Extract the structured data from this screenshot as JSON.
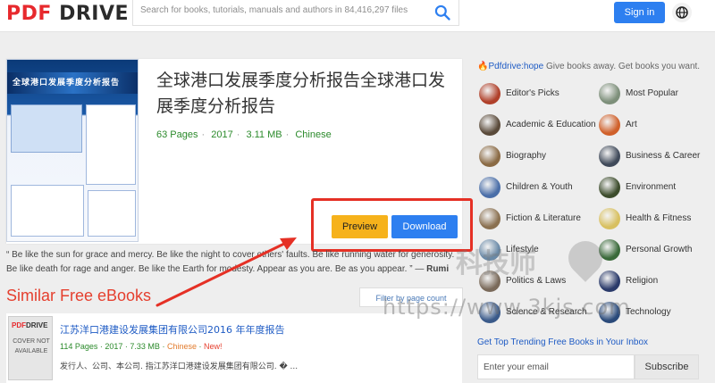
{
  "header": {
    "logo_pdf": "PDF",
    "logo_drive": "DRIVE",
    "search_placeholder": "Search for books, tutorials, manuals and authors in 84,416,297 files",
    "signin_label": "Sign in"
  },
  "book": {
    "cover_title": "全球港口发展季度分析报告",
    "title": "全球港口发展季度分析报告全球港口发展季度分析报告",
    "pages": "63 Pages",
    "year": "2017",
    "size": "3.11 MB",
    "language": "Chinese",
    "preview_label": "Preview",
    "download_label": "Download"
  },
  "quote": {
    "text": "“ Be like the sun for grace and mercy. Be like the night to cover others' faults. Be like running water for generosity. Be like death for rage and anger. Be like the Earth for modesty. Appear as you are. Be as you appear. ” — ",
    "author": "Rumi"
  },
  "similar": {
    "heading": "Similar Free eBooks",
    "filter_label": "Filter by page count",
    "items": [
      {
        "thumb_logo_pdf": "PDF",
        "thumb_logo_drive": "DRIVE",
        "thumb_text": "COVER NOT AVAILABLE",
        "title": "江苏洋口港建设发展集团有限公司2016 年年度报告",
        "pages": "114 Pages",
        "year": "2017",
        "size": "7.33 MB",
        "language": "Chinese",
        "badge": "New!",
        "snippet": "发行人、公司、本公司. 指江苏洋口港建设发展集团有限公司. �  ..."
      }
    ]
  },
  "sidebar": {
    "hope_brand": "Pdfdrive:hope",
    "hope_text": " Give books away. Get books you want.",
    "categories": [
      {
        "label": "Editor's Picks",
        "color": "#b0402a"
      },
      {
        "label": "Most Popular",
        "color": "#7d8f7a"
      },
      {
        "label": "Academic & Education",
        "color": "#5a4a3a"
      },
      {
        "label": "Art",
        "color": "#d0602a"
      },
      {
        "label": "Biography",
        "color": "#8a6a44"
      },
      {
        "label": "Business & Career",
        "color": "#404a5a"
      },
      {
        "label": "Children & Youth",
        "color": "#4a6ea8"
      },
      {
        "label": "Environment",
        "color": "#3c4c2c"
      },
      {
        "label": "Fiction & Literature",
        "color": "#8a7050"
      },
      {
        "label": "Health & Fitness",
        "color": "#d8c060"
      },
      {
        "label": "Lifestyle",
        "color": "#6a8aa8"
      },
      {
        "label": "Personal Growth",
        "color": "#3a6a3a"
      },
      {
        "label": "Politics & Laws",
        "color": "#7a6a5a"
      },
      {
        "label": "Religion",
        "color": "#2a3a6a"
      },
      {
        "label": "Science & Research",
        "color": "#3a5a8a"
      },
      {
        "label": "Technology",
        "color": "#2a4a7a"
      }
    ],
    "trend_label": "Get Top Trending Free Books in Your Inbox",
    "email_placeholder": "Enter your email",
    "subscribe_label": "Subscribe"
  },
  "watermark": {
    "text": "科技师",
    "url": "https://www.3kjs.com"
  },
  "colors": {
    "brand_red": "#e7292d",
    "primary_blue": "#2d7ff0",
    "preview_yellow": "#f6b21b",
    "meta_green": "#2b8a2b",
    "highlight_red": "#e53025"
  }
}
